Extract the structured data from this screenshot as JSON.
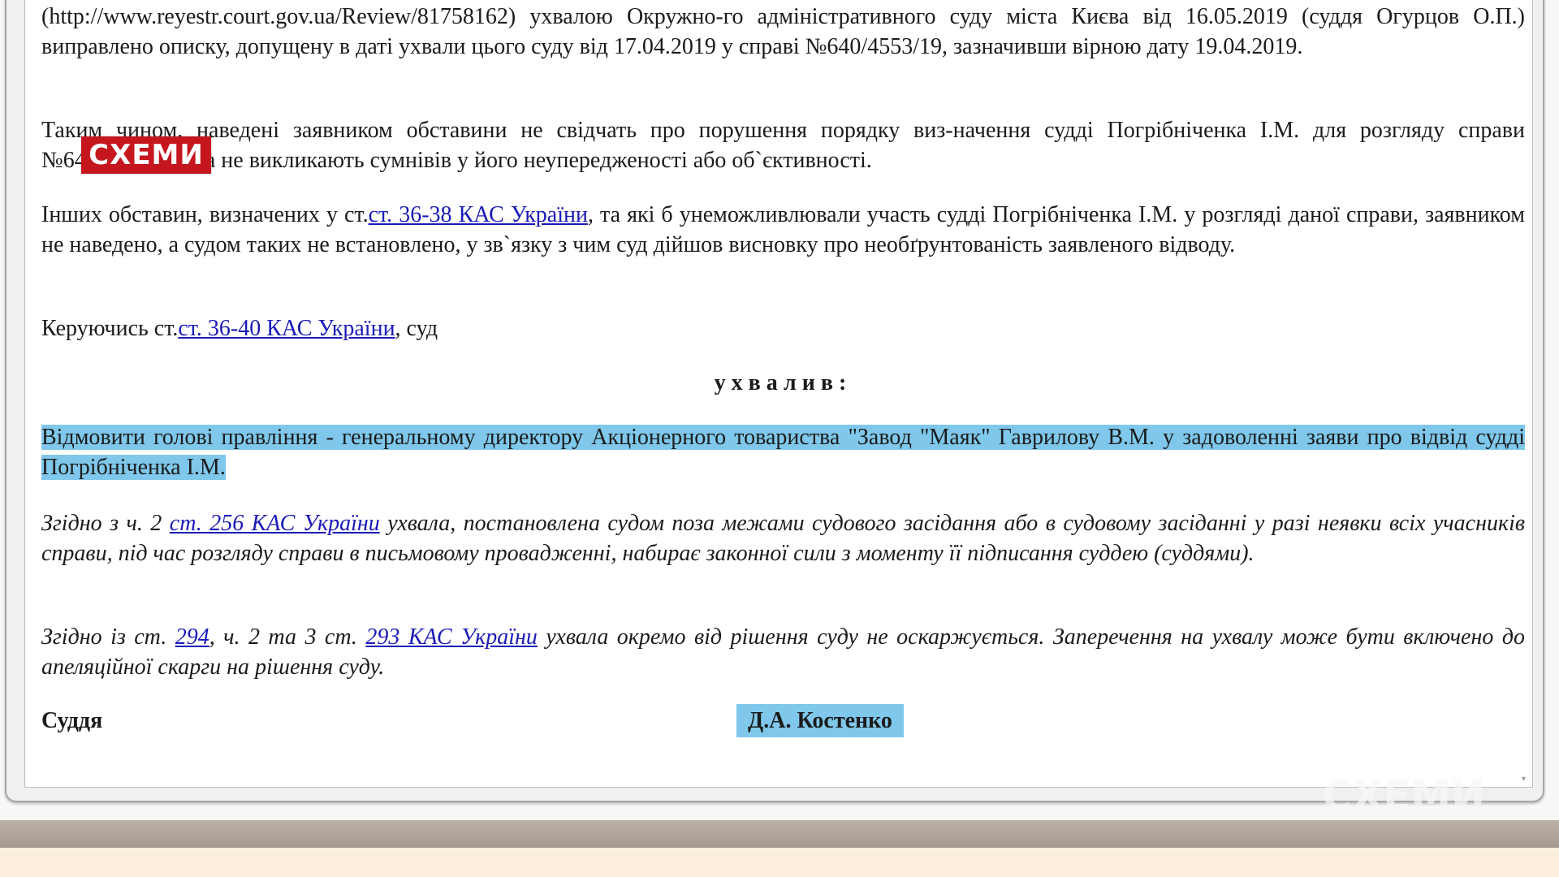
{
  "document": {
    "para1": {
      "text": "(http://www.reyestr.court.gov.ua/Review/81758162) ухвалою Окружно-го адміністративного суду міста Києва від 16.05.2019 (суддя Огурцов О.П.) виправлено описку, допущену в даті ухвали цього суду від 17.04.2019 у справі №640/4553/19, зазначивши вірною дату 19.04.2019."
    },
    "para2": {
      "text": "Таким чином, наведені заявником обставини не свідчать про порушення порядку виз-начення судді Погрібніченка І.М. для розгляду справи №640/12341/18 та не викликають сумнівів у його неупередженості або об`єктивності."
    },
    "para3": {
      "before": "Інших обставин, визначених у ст.",
      "link": "ст. 36-38 КАС України",
      "after": ", та які б унеможливлювали участь судді Погрібніченка І.М. у розгляді даної справи, заявником не наведено, а судом таких не встановлено, у зв`язку з чим суд дійшов висновку про необґрунтованість заявленого відводу."
    },
    "para4": {
      "before": "Керуючись ст.",
      "link": "ст. 36-40 КАС України",
      "after": ", суд"
    },
    "decision_heading": "ухвалив:",
    "para5": {
      "text": "Відмовити голові правління - генеральному директору Акціонерного товариства \"Завод \"Маяк\" Гаврилову В.М. у задоволенні  заяви про відвід судді Погрібніченка І.М."
    },
    "para6": {
      "before": "Згідно з ч. 2 ",
      "link": "ст. 256 КАС України",
      "after": " ухвала, постановлена судом поза межами судового засідання або в судовому засіданні у разі неявки всіх учасників справи, під час розгляду справи в письмовому провадженні, набирає законної сили з моменту її підписання суддею (суддями)."
    },
    "para7": {
      "before": "Згідно із ст. ",
      "link1": "294",
      "middle": ", ч. 2 та 3 ст. ",
      "link2": "293 КАС України",
      "after": " ухвала окремо від рішення суду не оскаржується. Заперечення на ухвалу може бути включено до апеляційної скарги на рішення суду."
    },
    "signature": {
      "label": "Суддя",
      "name": "Д.А. Костенко"
    }
  },
  "overlay": {
    "logo_text": "СХЕМИ",
    "watermark_text": "СХЕМИ"
  },
  "colors": {
    "highlight": "#7fc8eb",
    "link": "#1a1ab8",
    "logo_red": "#c5161d"
  },
  "icons": {
    "scroll_down": "scroll-down-arrow-icon"
  }
}
